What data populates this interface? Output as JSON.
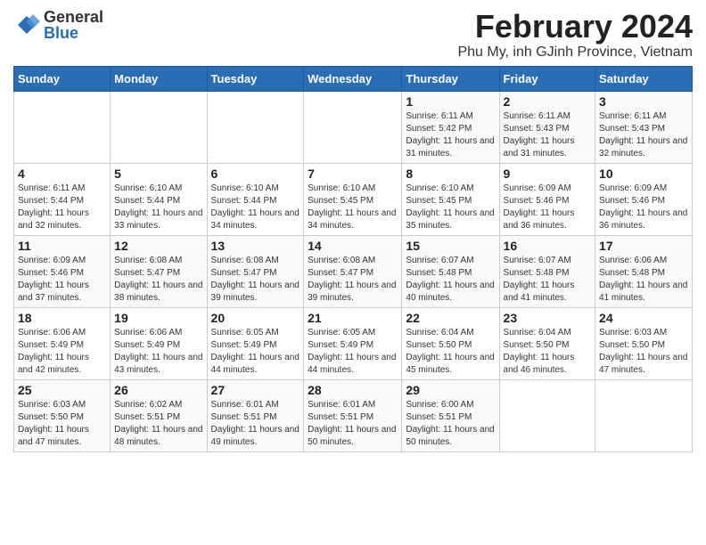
{
  "header": {
    "logo_line1": "General",
    "logo_line2": "Blue",
    "month": "February 2024",
    "location": "Phu My, inh GJinh Province, Vietnam"
  },
  "weekdays": [
    "Sunday",
    "Monday",
    "Tuesday",
    "Wednesday",
    "Thursday",
    "Friday",
    "Saturday"
  ],
  "weeks": [
    [
      {
        "day": "",
        "info": ""
      },
      {
        "day": "",
        "info": ""
      },
      {
        "day": "",
        "info": ""
      },
      {
        "day": "",
        "info": ""
      },
      {
        "day": "1",
        "info": "Sunrise: 6:11 AM\nSunset: 5:42 PM\nDaylight: 11 hours and 31 minutes."
      },
      {
        "day": "2",
        "info": "Sunrise: 6:11 AM\nSunset: 5:43 PM\nDaylight: 11 hours and 31 minutes."
      },
      {
        "day": "3",
        "info": "Sunrise: 6:11 AM\nSunset: 5:43 PM\nDaylight: 11 hours and 32 minutes."
      }
    ],
    [
      {
        "day": "4",
        "info": "Sunrise: 6:11 AM\nSunset: 5:44 PM\nDaylight: 11 hours and 32 minutes."
      },
      {
        "day": "5",
        "info": "Sunrise: 6:10 AM\nSunset: 5:44 PM\nDaylight: 11 hours and 33 minutes."
      },
      {
        "day": "6",
        "info": "Sunrise: 6:10 AM\nSunset: 5:44 PM\nDaylight: 11 hours and 34 minutes."
      },
      {
        "day": "7",
        "info": "Sunrise: 6:10 AM\nSunset: 5:45 PM\nDaylight: 11 hours and 34 minutes."
      },
      {
        "day": "8",
        "info": "Sunrise: 6:10 AM\nSunset: 5:45 PM\nDaylight: 11 hours and 35 minutes."
      },
      {
        "day": "9",
        "info": "Sunrise: 6:09 AM\nSunset: 5:46 PM\nDaylight: 11 hours and 36 minutes."
      },
      {
        "day": "10",
        "info": "Sunrise: 6:09 AM\nSunset: 5:46 PM\nDaylight: 11 hours and 36 minutes."
      }
    ],
    [
      {
        "day": "11",
        "info": "Sunrise: 6:09 AM\nSunset: 5:46 PM\nDaylight: 11 hours and 37 minutes."
      },
      {
        "day": "12",
        "info": "Sunrise: 6:08 AM\nSunset: 5:47 PM\nDaylight: 11 hours and 38 minutes."
      },
      {
        "day": "13",
        "info": "Sunrise: 6:08 AM\nSunset: 5:47 PM\nDaylight: 11 hours and 39 minutes."
      },
      {
        "day": "14",
        "info": "Sunrise: 6:08 AM\nSunset: 5:47 PM\nDaylight: 11 hours and 39 minutes."
      },
      {
        "day": "15",
        "info": "Sunrise: 6:07 AM\nSunset: 5:48 PM\nDaylight: 11 hours and 40 minutes."
      },
      {
        "day": "16",
        "info": "Sunrise: 6:07 AM\nSunset: 5:48 PM\nDaylight: 11 hours and 41 minutes."
      },
      {
        "day": "17",
        "info": "Sunrise: 6:06 AM\nSunset: 5:48 PM\nDaylight: 11 hours and 41 minutes."
      }
    ],
    [
      {
        "day": "18",
        "info": "Sunrise: 6:06 AM\nSunset: 5:49 PM\nDaylight: 11 hours and 42 minutes."
      },
      {
        "day": "19",
        "info": "Sunrise: 6:06 AM\nSunset: 5:49 PM\nDaylight: 11 hours and 43 minutes."
      },
      {
        "day": "20",
        "info": "Sunrise: 6:05 AM\nSunset: 5:49 PM\nDaylight: 11 hours and 44 minutes."
      },
      {
        "day": "21",
        "info": "Sunrise: 6:05 AM\nSunset: 5:49 PM\nDaylight: 11 hours and 44 minutes."
      },
      {
        "day": "22",
        "info": "Sunrise: 6:04 AM\nSunset: 5:50 PM\nDaylight: 11 hours and 45 minutes."
      },
      {
        "day": "23",
        "info": "Sunrise: 6:04 AM\nSunset: 5:50 PM\nDaylight: 11 hours and 46 minutes."
      },
      {
        "day": "24",
        "info": "Sunrise: 6:03 AM\nSunset: 5:50 PM\nDaylight: 11 hours and 47 minutes."
      }
    ],
    [
      {
        "day": "25",
        "info": "Sunrise: 6:03 AM\nSunset: 5:50 PM\nDaylight: 11 hours and 47 minutes."
      },
      {
        "day": "26",
        "info": "Sunrise: 6:02 AM\nSunset: 5:51 PM\nDaylight: 11 hours and 48 minutes."
      },
      {
        "day": "27",
        "info": "Sunrise: 6:01 AM\nSunset: 5:51 PM\nDaylight: 11 hours and 49 minutes."
      },
      {
        "day": "28",
        "info": "Sunrise: 6:01 AM\nSunset: 5:51 PM\nDaylight: 11 hours and 50 minutes."
      },
      {
        "day": "29",
        "info": "Sunrise: 6:00 AM\nSunset: 5:51 PM\nDaylight: 11 hours and 50 minutes."
      },
      {
        "day": "",
        "info": ""
      },
      {
        "day": "",
        "info": ""
      }
    ]
  ]
}
